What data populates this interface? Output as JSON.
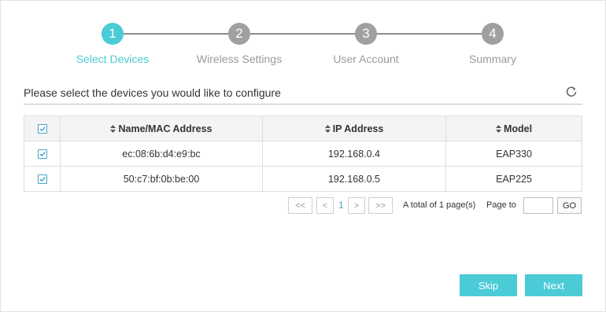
{
  "stepper": {
    "steps": [
      {
        "number": "1",
        "label": "Select Devices",
        "active": true
      },
      {
        "number": "2",
        "label": "Wireless Settings",
        "active": false
      },
      {
        "number": "3",
        "label": "User Account",
        "active": false
      },
      {
        "number": "4",
        "label": "Summary",
        "active": false
      }
    ],
    "active_color": "#4acbd6",
    "inactive_color": "#a0a0a0"
  },
  "section": {
    "title": "Please select the devices you would like to configure",
    "refresh_icon": "refresh-icon"
  },
  "table": {
    "headers": {
      "name": "Name/MAC Address",
      "ip": "IP Address",
      "model": "Model"
    },
    "select_all_checked": true,
    "rows": [
      {
        "checked": true,
        "name": "ec:08:6b:d4:e9:bc",
        "ip": "192.168.0.4",
        "model": "EAP330"
      },
      {
        "checked": true,
        "name": "50:c7:bf:0b:be:00",
        "ip": "192.168.0.5",
        "model": "EAP225"
      }
    ]
  },
  "pagination": {
    "first": "<<",
    "prev": "<",
    "current_page": "1",
    "next": ">",
    "last": ">>",
    "total_text": "A total of 1 page(s)",
    "page_to_label": "Page to",
    "page_input_value": "",
    "go_label": "GO"
  },
  "actions": {
    "skip_label": "Skip",
    "next_label": "Next"
  }
}
